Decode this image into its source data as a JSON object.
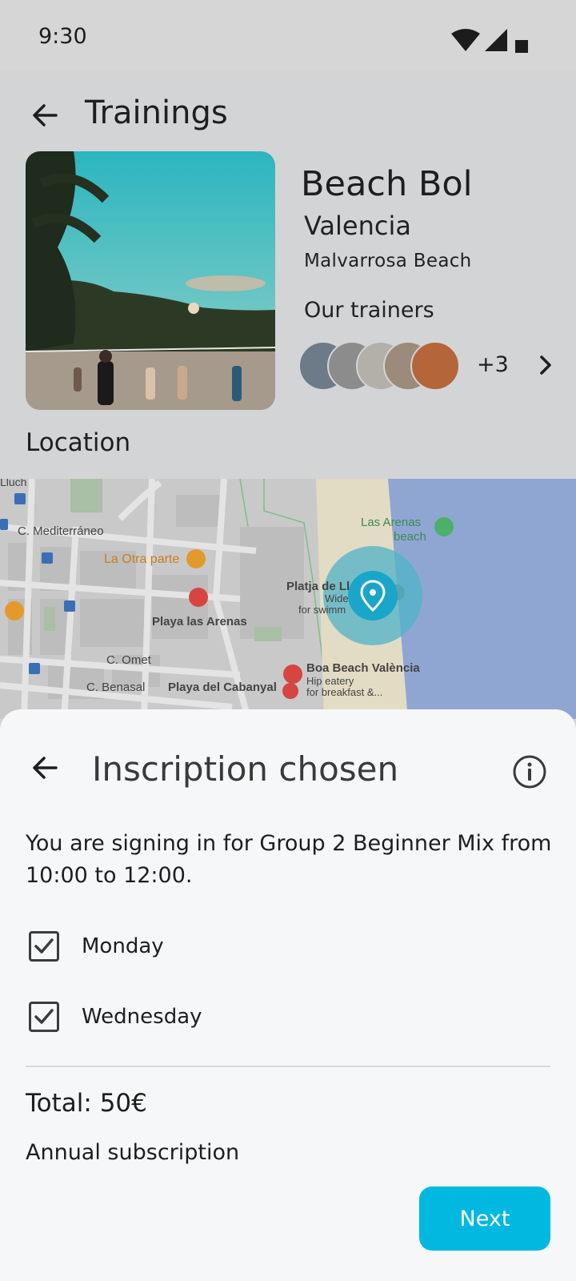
{
  "status_bar": {
    "time": "9:30"
  },
  "header": {
    "title": "Trainings"
  },
  "club": {
    "name": "Beach Bol",
    "city": "Valencia",
    "place": "Malvarrosa Beach",
    "trainers_title": "Our trainers",
    "more_trainers": "+3"
  },
  "location": {
    "title": "Location",
    "map_labels": {
      "street1": "C. Mediterráneo",
      "street2": "C. Omet",
      "street3": "C. Benasal",
      "street_top": "Lluch",
      "poi1": "La Otra parte",
      "poi2": "Playa las Arenas",
      "poi3": "Playa del Cabanyal",
      "poi4": "Boa Beach València",
      "poi4_sub1": "Hip eatery",
      "poi4_sub2": "for breakfast &...",
      "poi5": "Las Arenas",
      "poi5_line2": "beach",
      "poi6": "Platja de Ll",
      "poi6_sub1": "Wide",
      "poi6_sub2": "for swimm"
    }
  },
  "sheet": {
    "title": "Inscription chosen",
    "description": "You are signing in for Group 2 Beginner Mix from 10:00 to 12:00.",
    "days": [
      {
        "label": "Monday",
        "checked": true
      },
      {
        "label": "Wednesday",
        "checked": true
      }
    ],
    "total": "Total: 50€",
    "subscription": "Annual subscription",
    "next_label": "Next"
  },
  "colors": {
    "accent": "#00b8e0",
    "map_sea": "#8fa6d3",
    "map_sand": "#e2dcc4",
    "pin": "#1aa6c9"
  }
}
